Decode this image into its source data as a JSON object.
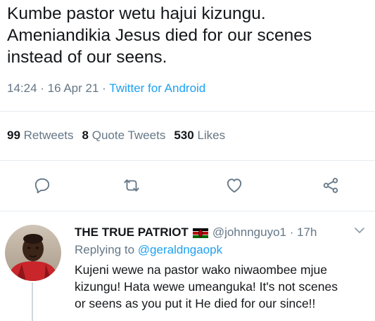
{
  "tweet": {
    "text": "Kumbe pastor wetu hajui kizungu.\nAmeniandikia Jesus died for our scenes\ninstead of our seens.",
    "time": "14:24 · 16 Apr 21",
    "separator": " · ",
    "source": "Twitter for Android"
  },
  "stats": {
    "retweets_count": "99",
    "retweets_label": "Retweets",
    "quotes_count": "8",
    "quotes_label": "Quote Tweets",
    "likes_count": "530",
    "likes_label": "Likes"
  },
  "actions": {
    "reply_icon": "reply-icon",
    "retweet_icon": "retweet-icon",
    "like_icon": "heart-icon",
    "share_icon": "share-icon"
  },
  "reply": {
    "name": "THE TRUE PATRIOT",
    "flag": "kenya-flag",
    "handle": "@johnnguyo1 · 17h",
    "replying_prefix": "Replying to",
    "replying_to": "@geraldngaopk",
    "text": "Kujeni wewe na pastor wako niwaombee mjue\nkizungu! Hata wewe umeanguka! It's not scenes\nor seens as you put it He died for our since!!"
  },
  "colors": {
    "text": "#14171a",
    "secondary": "#657786",
    "accent": "#1da1f2",
    "divider": "#e6ecf0"
  }
}
